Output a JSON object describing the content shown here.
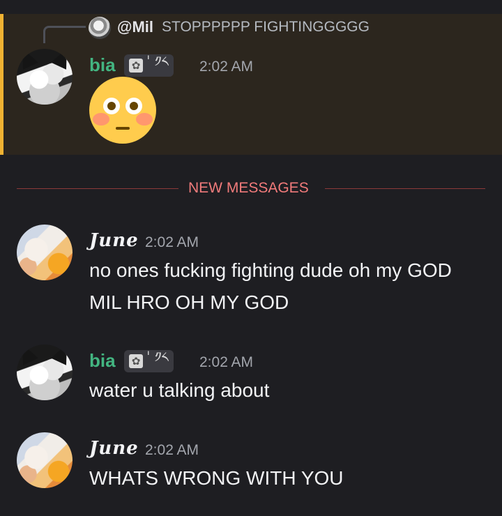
{
  "highlight_color": "#f0b232",
  "reply": {
    "author": "@Mil",
    "text": "STOPPPPPP FIGHTINGGGGG"
  },
  "messages": [
    {
      "author": "bia",
      "tag_icon": "flower-icon",
      "tag_text": "ˈ ༡༨",
      "time": "2:02 AM",
      "emoji": "flushed-face"
    },
    {
      "author": "June",
      "time": "2:02 AM",
      "lines": [
        "no ones fucking fighting dude oh my GOD",
        "MIL HRO OH MY GOD"
      ]
    },
    {
      "author": "bia",
      "tag_text": "ˈ ༡༨",
      "time": "2:02 AM",
      "lines": [
        "water u talking about"
      ]
    },
    {
      "author": "June",
      "time": "2:02 AM",
      "lines": [
        "WHATS WRONG WITH YOU"
      ]
    }
  ],
  "divider": {
    "label": "NEW MESSAGES"
  }
}
